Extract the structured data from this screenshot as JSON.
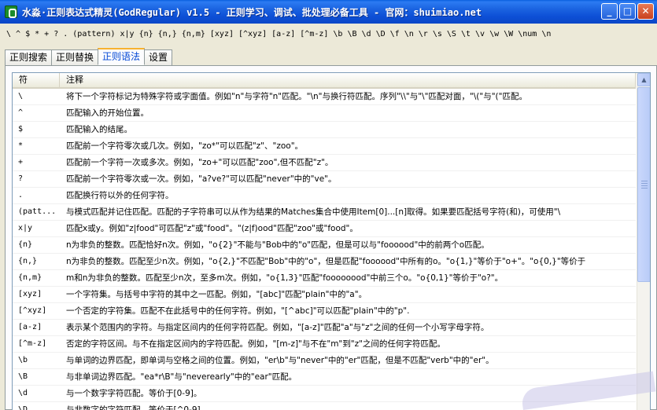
{
  "window": {
    "title": "水淼·正则表达式精灵(GodRegular) v1.5 - 正则学习、调试、批处理必备工具 - 官网：shuimiao.net",
    "buttons": {
      "minimize": "_",
      "maximize": "□",
      "close": "✕"
    }
  },
  "syntax_strip": "\\ ^ $ * + ? . (pattern) x|y {n} {n,} {n,m} [xyz] [^xyz] [a-z] [^m-z] \\b \\B \\d \\D \\f \\n \\r \\s \\S \\t \\v \\w \\W \\num \\n",
  "tabs": [
    {
      "label": "正则搜索",
      "active": false
    },
    {
      "label": "正则替换",
      "active": false
    },
    {
      "label": "正则语法",
      "active": true
    },
    {
      "label": "设置",
      "active": false
    }
  ],
  "table": {
    "headers": {
      "symbol": "符",
      "note": "注释"
    },
    "rows": [
      {
        "symbol": "\\",
        "note": "将下一个字符标记为特殊字符或字面值。例如\"n\"与字符\"n\"匹配。\"\\n\"与换行符匹配。序列\"\\\\\"与\"\\\"匹配对面，\"\\(\"与\"(\"匹配。"
      },
      {
        "symbol": "^",
        "note": "匹配输入的开始位置。"
      },
      {
        "symbol": "$",
        "note": "匹配输入的结尾。"
      },
      {
        "symbol": "*",
        "note": "匹配前一个字符零次或几次。例如，\"zo*\"可以匹配\"z\"、\"zoo\"。"
      },
      {
        "symbol": "+",
        "note": "匹配前一个字符一次或多次。例如，\"zo+\"可以匹配\"zoo\",但不匹配\"z\"。"
      },
      {
        "symbol": "?",
        "note": "匹配前一个字符零次或一次。例如，\"a?ve?\"可以匹配\"never\"中的\"ve\"。"
      },
      {
        "symbol": ".",
        "note": "匹配换行符以外的任何字符。"
      },
      {
        "symbol": "(patt...",
        "note": "与模式匹配并记住匹配。匹配的子字符串可以从作为结果的Matches集合中使用Item[0]...[n]取得。如果要匹配括号字符(和)，可使用\"\\"
      },
      {
        "symbol": "x|y",
        "note": "匹配x或y。例如\"z|food\"可匹配\"z\"或\"food\"。\"(z|f)ood\"匹配\"zoo\"或\"food\"。"
      },
      {
        "symbol": "{n}",
        "note": "n为非负的整数。匹配恰好n次。例如，\"o{2}\"不能与\"Bob中的\"o\"匹配，但是可以与\"foooood\"中的前两个o匹配。"
      },
      {
        "symbol": "{n,}",
        "note": "n为非负的整数。匹配至少n次。例如，\"o{2,}\"不匹配\"Bob\"中的\"o\"，但是匹配\"foooood\"中所有的o。\"o{1,}\"等价于\"o+\"。\"o{0,}\"等价于"
      },
      {
        "symbol": "{n,m}",
        "note": "m和n为非负的整数。匹配至少n次，至多m次。例如，\"o{1,3}\"匹配\"foooooood\"中前三个o。\"o{0,1}\"等价于\"o?\"。"
      },
      {
        "symbol": "[xyz]",
        "note": "一个字符集。与括号中字符的其中之一匹配。例如，\"[abc]\"匹配\"plain\"中的\"a\"。"
      },
      {
        "symbol": "[^xyz]",
        "note": "一个否定的字符集。匹配不在此括号中的任何字符。例如，\"[^abc]\"可以匹配\"plain\"中的\"p\"."
      },
      {
        "symbol": "[a-z]",
        "note": "表示某个范围内的字符。与指定区间内的任何字符匹配。例如，\"[a-z]\"匹配\"a\"与\"z\"之间的任何一个小写字母字符。"
      },
      {
        "symbol": "[^m-z]",
        "note": "否定的字符区间。与不在指定区间内的字符匹配。例如，\"[m-z]\"与不在\"m\"到\"z\"之间的任何字符匹配。"
      },
      {
        "symbol": "\\b",
        "note": "与单词的边界匹配，即单词与空格之间的位置。例如，\"er\\b\"与\"never\"中的\"er\"匹配，但是不匹配\"verb\"中的\"er\"。"
      },
      {
        "symbol": "\\B",
        "note": "与非单词边界匹配。\"ea*r\\B\"与\"neverearly\"中的\"ear\"匹配。"
      },
      {
        "symbol": "\\d",
        "note": "与一个数字字符匹配。等价于[0-9]。"
      },
      {
        "symbol": "\\D",
        "note": "与非数字的字符匹配。等价于[^0-9]。"
      }
    ]
  },
  "icons": {
    "app": "regex-app-icon",
    "scroll_up": "scroll-up-arrow-icon"
  }
}
